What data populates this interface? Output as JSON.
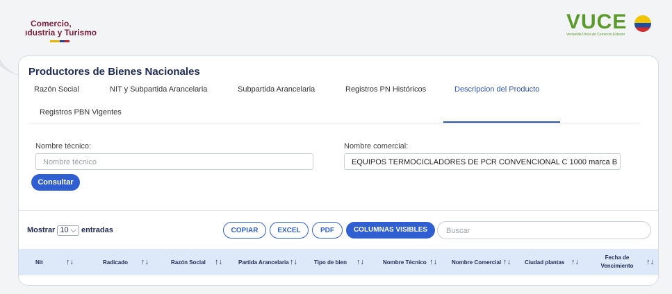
{
  "logo": {
    "line1": "Comercio,",
    "line2": "ıdustria y Turismo",
    "vuce_word": "VUCE",
    "vuce_sub": "Ventanilla Única de Comercio Exterior"
  },
  "page_title": "Productores de Bienes Nacionales",
  "tabs": [
    "Razón Social",
    "NIT y Subpartida Arancelaria",
    "Subpartida Arancelaria",
    "Registros PN Históricos",
    "Descripcion del Producto",
    "Registros PBN Vigentes"
  ],
  "active_tab": "Descripcion del Producto",
  "form": {
    "nombre_tecnico_label": "Nombre técnico:",
    "nombre_tecnico_placeholder": "Nombre técnico",
    "nombre_comercial_label": "Nombre comercial:",
    "nombre_comercial_value": "EQUIPOS TERMOCICLADORES DE PCR CONVENCIONAL C 1000 marca B",
    "submit": "Consultar"
  },
  "table_controls": {
    "show_prefix": "Mostrar",
    "page_size": "10",
    "show_suffix": "entradas",
    "buttons": [
      "COPIAR",
      "EXCEL",
      "PDF"
    ],
    "columns_button": "COLUMNAS VISIBLES",
    "search_placeholder": "Buscar"
  },
  "table_headers": [
    "Nit",
    "Radicado",
    "Razón Social",
    "Partida Arancelaria",
    "Tipo de bien",
    "Nombre Técnico",
    "Nombre Comercial",
    "Ciudad plantas",
    "Fecha de Vencimiento"
  ],
  "sort_icon": "sort-arrows-icon",
  "colors": {
    "accent": "#2f5fd0",
    "title": "#1d2a53",
    "header_bg": "#dde8f8"
  }
}
